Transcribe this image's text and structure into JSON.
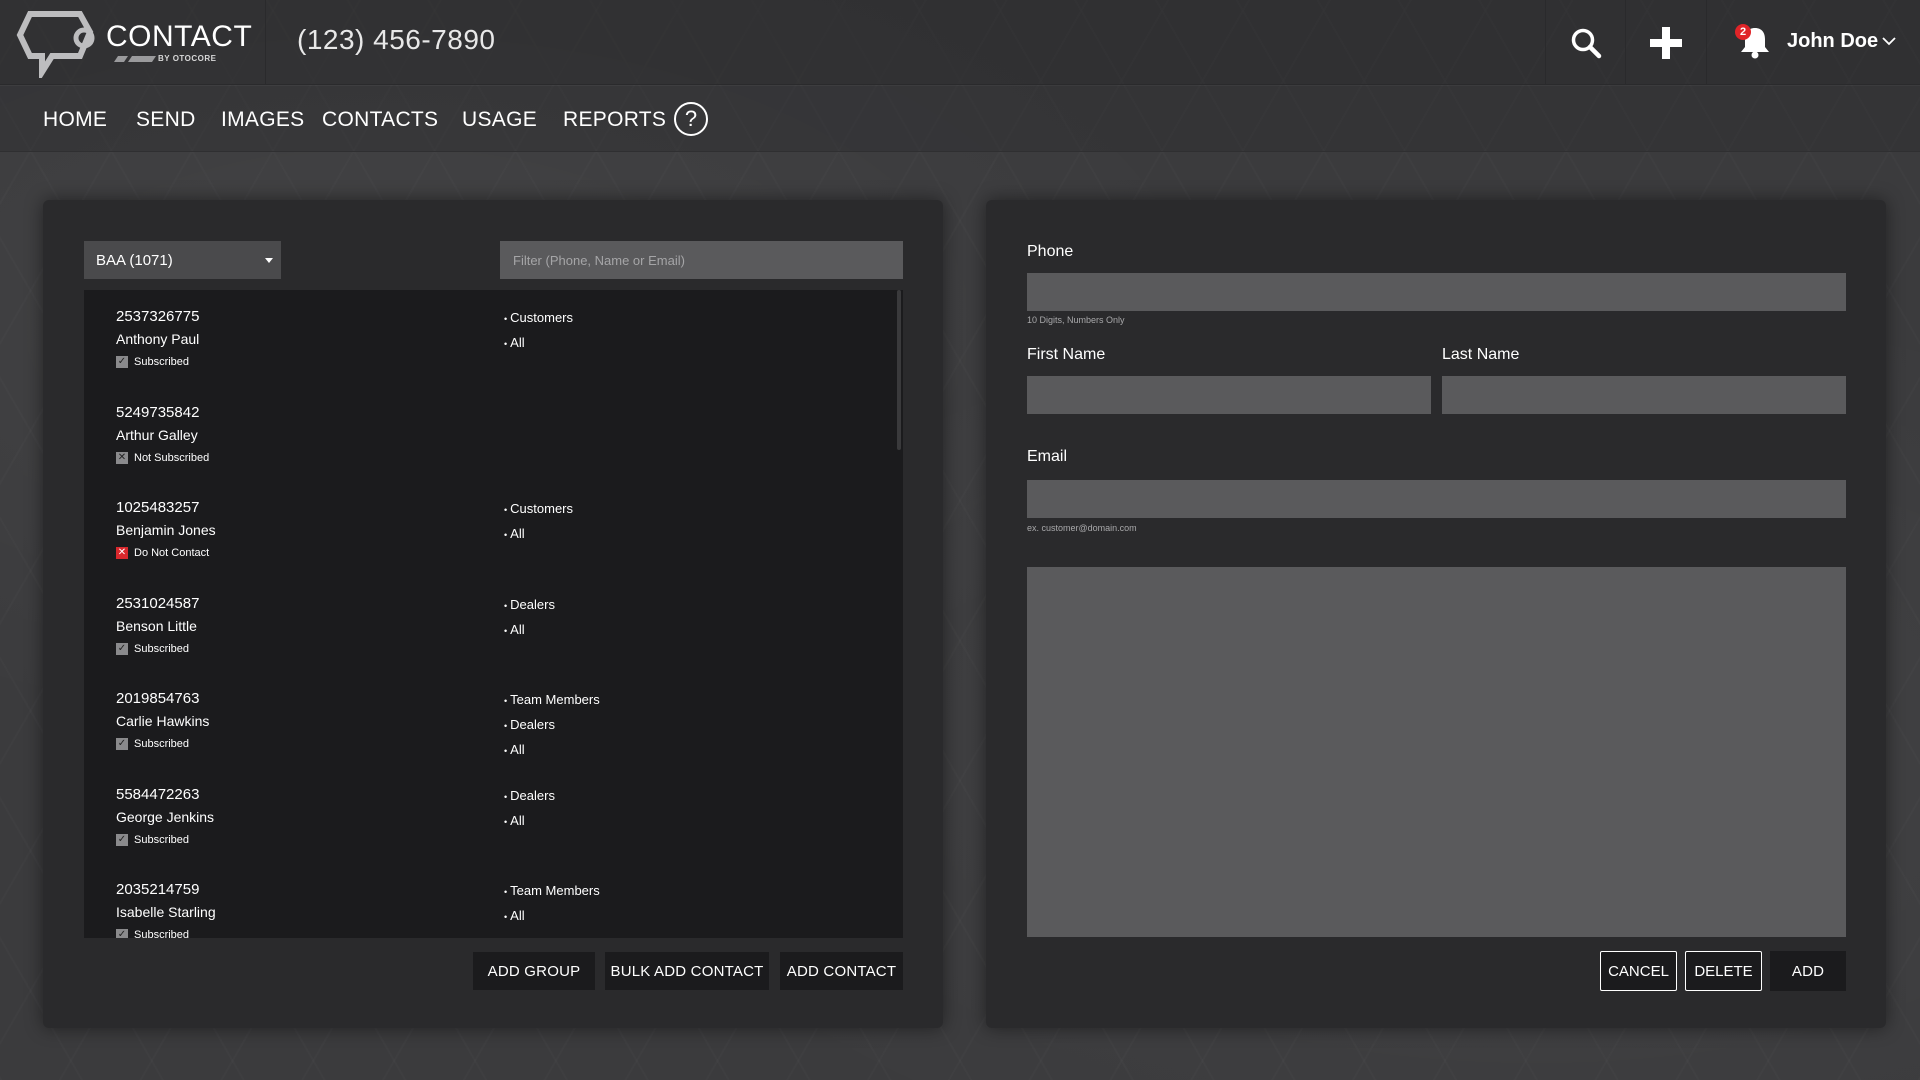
{
  "app": {
    "logo_text": "CONTACT",
    "logo_sub": "BY OTOCORE",
    "phone_number": "(123) 456-7890",
    "notification_count": "2",
    "user_name": "John Doe"
  },
  "nav": {
    "items": [
      "HOME",
      "SEND",
      "IMAGES",
      "CONTACTS",
      "USAGE",
      "REPORTS"
    ],
    "help_label": "?"
  },
  "contacts_panel": {
    "group_selected": "BAA (1071)",
    "filter_placeholder": "Filter (Phone, Name or Email)",
    "contacts": [
      {
        "phone": "2537326775",
        "name": "Anthony Paul",
        "status": "Subscribed",
        "status_type": "subscribed",
        "groups": [
          "Customers",
          "All"
        ]
      },
      {
        "phone": "5249735842",
        "name": "Arthur Galley",
        "status": "Not Subscribed",
        "status_type": "not",
        "groups": []
      },
      {
        "phone": "1025483257",
        "name": "Benjamin Jones",
        "status": "Do Not Contact",
        "status_type": "dnc",
        "groups": [
          "Customers",
          "All"
        ]
      },
      {
        "phone": "2531024587",
        "name": "Benson Little",
        "status": "Subscribed",
        "status_type": "subscribed",
        "groups": [
          "Dealers",
          "All"
        ]
      },
      {
        "phone": "2019854763",
        "name": "Carlie Hawkins",
        "status": "Subscribed",
        "status_type": "subscribed",
        "groups": [
          "Team Members",
          "Dealers",
          "All"
        ]
      },
      {
        "phone": "5584472263",
        "name": "George Jenkins",
        "status": "Subscribed",
        "status_type": "subscribed",
        "groups": [
          "Dealers",
          "All"
        ]
      },
      {
        "phone": "2035214759",
        "name": "Isabelle Starling",
        "status": "Subscribed",
        "status_type": "subscribed",
        "groups": [
          "Team Members",
          "All"
        ]
      }
    ],
    "buttons": {
      "add_group": "ADD GROUP",
      "bulk_add_contact": "BULK ADD CONTACT",
      "add_contact": "ADD CONTACT"
    }
  },
  "form_panel": {
    "phone_label": "Phone",
    "phone_hint": "10 Digits, Numbers Only",
    "first_name_label": "First Name",
    "last_name_label": "Last Name",
    "email_label": "Email",
    "email_hint": "ex. customer@domain.com",
    "buttons": {
      "cancel": "CANCEL",
      "delete": "DELETE",
      "add": "ADD"
    }
  },
  "colors": {
    "background": "#3b3b3d",
    "panel": "#2a2a2c",
    "list_bg": "#1b1b1d",
    "input_bg": "#5a5a5c",
    "dnc_red": "#d9282d",
    "badge_red": "#e02428"
  }
}
